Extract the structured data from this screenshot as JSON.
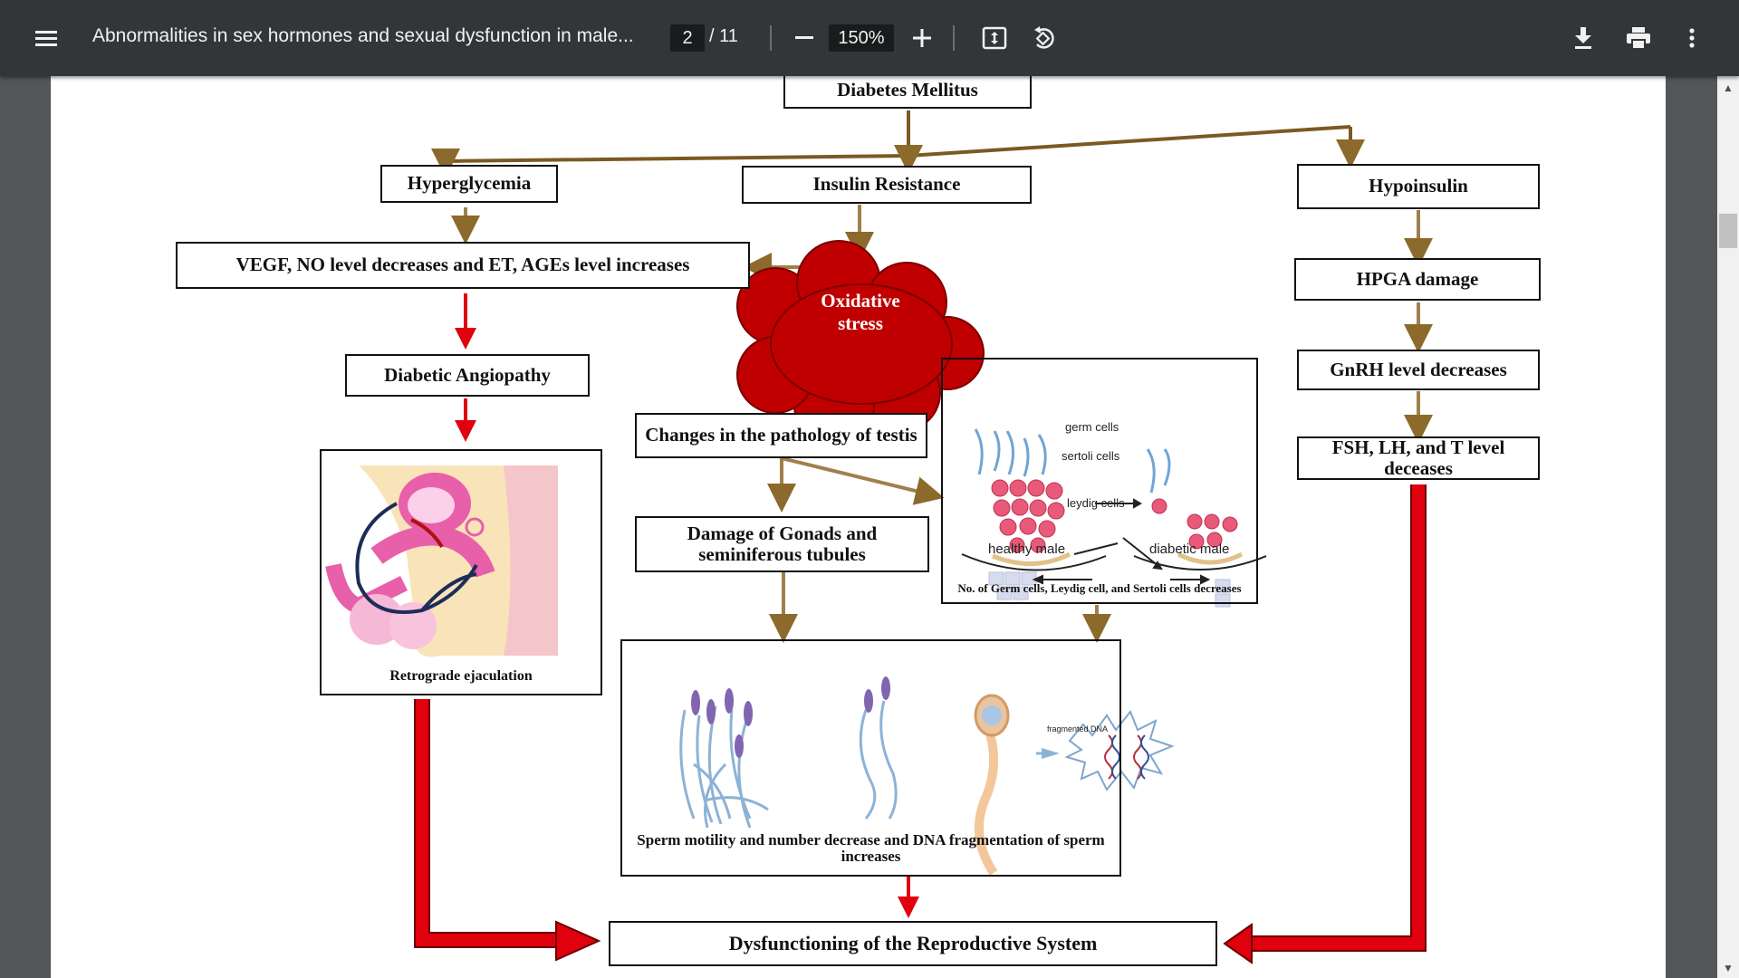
{
  "toolbar": {
    "title": "Abnormalities in sex hormones and sexual dysfunction in male...",
    "page_current": "2",
    "page_total": "/ 11",
    "zoom": "150%"
  },
  "icons": [
    "menu-icon",
    "minus-icon",
    "plus-icon",
    "fit-page-icon",
    "rotate-icon",
    "download-icon",
    "print-icon",
    "more-vert-icon"
  ],
  "diagram": {
    "root": "Diabetes Mellitus",
    "hyperglycemia": "Hyperglycemia",
    "insulin_resistance": "Insulin Resistance",
    "hypoinsulin": "Hypoinsulin",
    "vegf": "VEGF, NO level decreases and ET, AGEs level increases",
    "oxidative_stress": "Oxidative stress",
    "hpga": "HPGA damage",
    "gnrh": "GnRH level decreases",
    "angiopathy": "Diabetic Angiopathy",
    "pathology": "Changes in the pathology of testis",
    "fsh": "FSH, LH, and T level deceases",
    "gonads": "Damage of Gonads and seminiferous tubules",
    "retrograde": "Retrograde ejaculation",
    "germ_cells": "germ cells",
    "sertoli_cells": "sertoli cells",
    "leydig_cells": "leydig cells",
    "healthy": "healthy male",
    "diabetic": "diabetic male",
    "cells_caption": "No. of Germ cells, Leydig cell, and Sertoli cells decreases",
    "fragmented": "fragmented DNA",
    "sperm_caption": "Sperm motility and number decrease and DNA fragmentation of sperm increases",
    "dysfunction": "Dysfunctioning of the Reproductive System"
  },
  "colors": {
    "brown_arrow": "#8b6a2b",
    "red_arrow": "#e0000e",
    "cloud": "#c00000"
  }
}
